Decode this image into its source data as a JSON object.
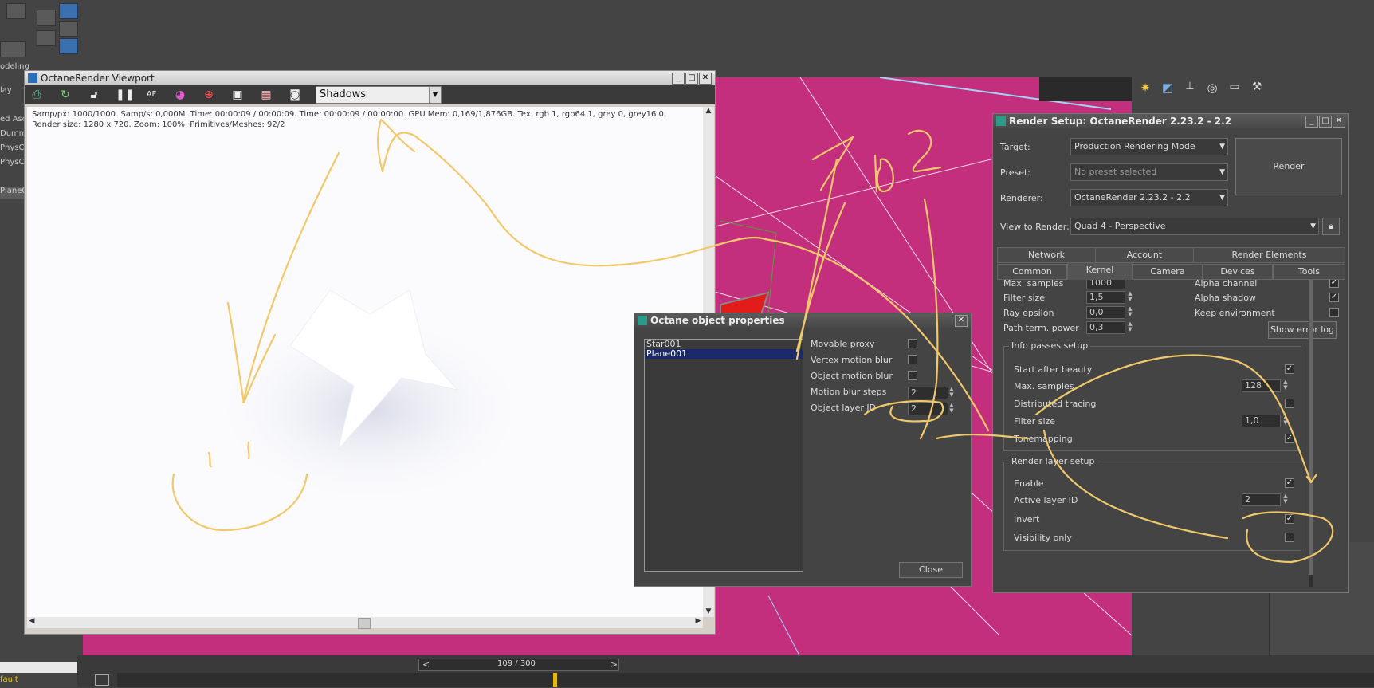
{
  "app": {
    "left_panel": {
      "modeling_label": "odeling",
      "display_label": "lay",
      "scene_items": [
        "ed Asc",
        "Dummy",
        "PhysCa",
        "PhysCa",
        "Plane0"
      ],
      "default_label": "fault"
    },
    "timeline": {
      "frame_display": "109 / 300",
      "prev": "<",
      "next": ">"
    }
  },
  "octane_viewport": {
    "title": "OctaneRender Viewport",
    "render_mode": "Shadows",
    "info_line1": "Samp/px: 1000/1000.   Samp/s: 0,000M.   Time: 00:00:09 / 00:00:09.   Time: 00:00:09 / 00:00:00.   GPU Mem: 0,169/1,876GB.   Tex: rgb 1, rgb64 1, grey 0, grey16 0.",
    "info_line2": "Render size: 1280 x 720.   Zoom: 100%.   Primitives/Meshes: 92/2",
    "toolbar_icons": [
      "export-icon",
      "refresh-icon",
      "lock-icon",
      "pause-icon",
      "focus-icon",
      "color-picker-icon",
      "material-picker-icon",
      "display-icon",
      "region-icon",
      "camera-icon"
    ]
  },
  "object_properties": {
    "title": "Octane object properties",
    "objects": [
      {
        "name": "Star001",
        "selected": false
      },
      {
        "name": "Plane001",
        "selected": true
      }
    ],
    "options": [
      {
        "label": "Movable proxy",
        "checked": false
      },
      {
        "label": "Vertex motion blur",
        "checked": false
      },
      {
        "label": "Object motion blur",
        "checked": false
      }
    ],
    "motion_blur_steps_label": "Motion blur steps",
    "motion_blur_steps_value": "2",
    "object_layer_id_label": "Object layer ID",
    "object_layer_id_value": "2",
    "close_label": "Close"
  },
  "render_setup": {
    "title": "Render Setup: OctaneRender 2.23.2 - 2.2",
    "target_label": "Target:",
    "target_value": "Production Rendering Mode",
    "preset_label": "Preset:",
    "preset_value": "No preset selected",
    "renderer_label": "Renderer:",
    "renderer_value": "OctaneRender 2.23.2 - 2.2",
    "view_label": "View to Render:",
    "view_value": "Quad 4 - Perspective",
    "render_button": "Render",
    "tabs_row1": [
      "Network",
      "Account",
      "Render Elements"
    ],
    "tabs_row2": [
      "Common",
      "Kernel",
      "Camera",
      "Devices",
      "Tools"
    ],
    "active_tab": "Kernel",
    "kernel": {
      "max_samples_label": "Max. samples",
      "max_samples_value": "1000",
      "filter_size_label": "Filter size",
      "filter_size_value": "1,5",
      "ray_epsilon_label": "Ray epsilon",
      "ray_epsilon_value": "0,0",
      "path_term_label": "Path term. power",
      "path_term_value": "0,3",
      "alpha_channel_label": "Alpha channel",
      "alpha_channel_checked": true,
      "alpha_shadow_label": "Alpha shadow",
      "alpha_shadow_checked": true,
      "keep_env_label": "Keep environment",
      "keep_env_checked": false,
      "show_error_log": "Show error log"
    },
    "info_passes": {
      "title": "Info passes setup",
      "start_after_beauty_label": "Start after beauty",
      "start_after_beauty_checked": true,
      "max_samples_label": "Max. samples",
      "max_samples_value": "128",
      "distributed_tracing_label": "Distributed tracing",
      "distributed_tracing_checked": false,
      "filter_size_label": "Filter size",
      "filter_size_value": "1,0",
      "tonemapping_label": "Tonemapping",
      "tonemapping_checked": true
    },
    "render_layer": {
      "title": "Render layer setup",
      "enable_label": "Enable",
      "enable_checked": true,
      "active_layer_label": "Active layer ID",
      "active_layer_value": "2",
      "invert_label": "Invert",
      "invert_checked": true,
      "visibility_only_label": "Visibility only",
      "visibility_only_checked": false
    }
  },
  "annotation": {
    "handwritten_text": "ID2",
    "color": "#f1c86b"
  }
}
